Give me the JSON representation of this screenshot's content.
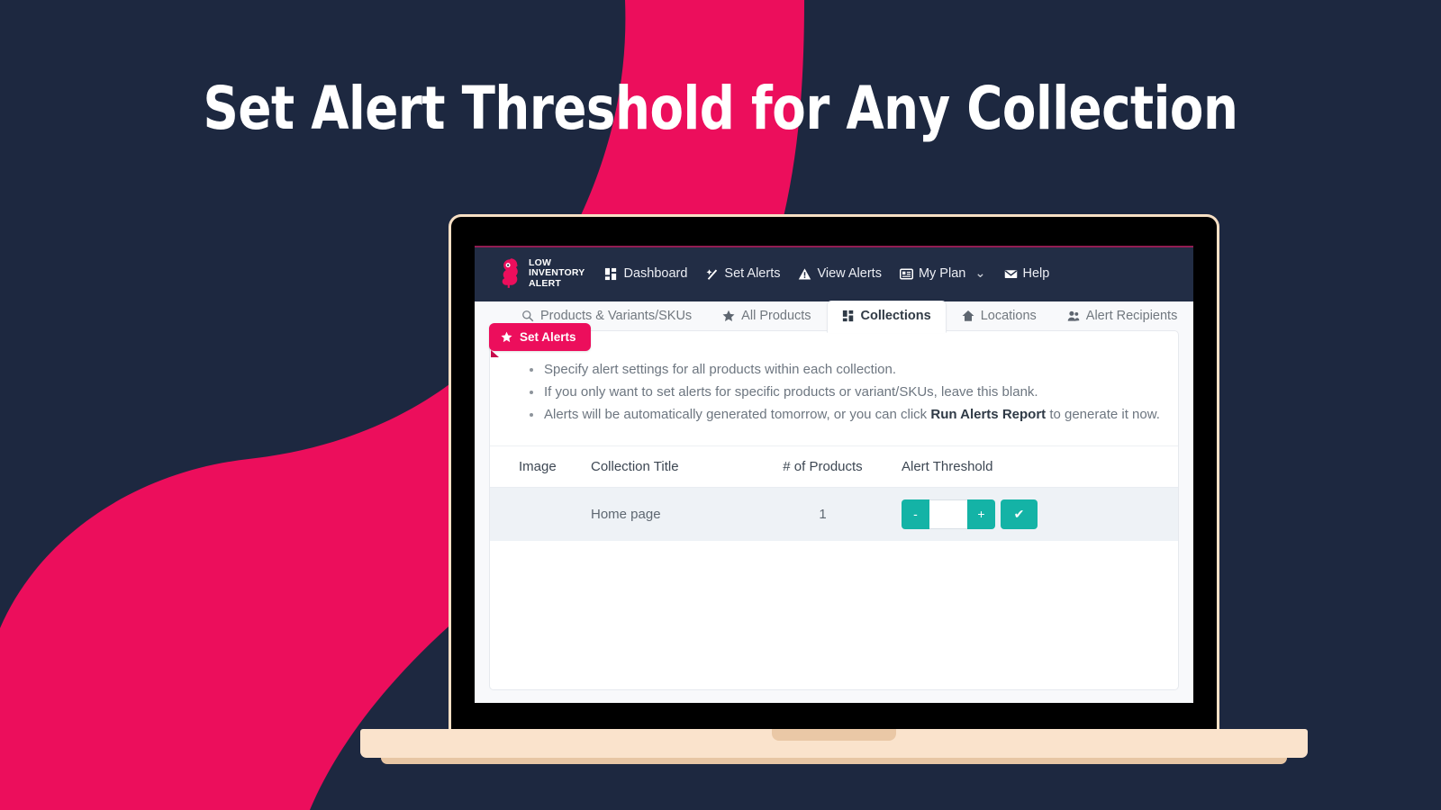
{
  "hero": {
    "title": "Set Alert Threshold for Any Collection"
  },
  "colors": {
    "background_navy": "#1d2840",
    "accent_pink": "#ec0e5c",
    "nav_navy": "#222d45",
    "teal": "#14b3a6",
    "laptop_base": "#fae3cc",
    "row_bg": "#eef2f6"
  },
  "app": {
    "brand": {
      "icon": "owl-bird-logo-icon",
      "line1": "LOW",
      "line2": "INVENTORY",
      "line3": "ALERT"
    },
    "nav_items": [
      {
        "label": "Dashboard",
        "icon": "grid-squares-icon"
      },
      {
        "label": "Set Alerts",
        "icon": "magic-wand-icon"
      },
      {
        "label": "View Alerts",
        "icon": "warning-triangle-icon"
      },
      {
        "label": "My Plan",
        "icon": "id-card-icon",
        "chevron": "⌄"
      },
      {
        "label": "Help",
        "icon": "envelope-icon"
      }
    ],
    "badge": {
      "label": "Set Alerts",
      "icon": "star-icon"
    },
    "tabs": [
      {
        "label": "Products & Variants/SKUs",
        "icon": "search-icon",
        "active": false
      },
      {
        "label": "All Products",
        "icon": "star-icon",
        "active": false
      },
      {
        "label": "Collections",
        "icon": "grid-squares-icon",
        "active": true
      },
      {
        "label": "Locations",
        "icon": "home-icon",
        "active": false
      },
      {
        "label": "Alert Recipients",
        "icon": "people-icon",
        "active": false
      },
      {
        "label": "",
        "icon": "gear-settings-icon",
        "active": false
      }
    ],
    "hints": [
      {
        "text": "Specify alert settings for all products within each collection."
      },
      {
        "text": "If you only want to set alerts for specific products or variant/SKUs, leave this blank."
      },
      {
        "pre": "Alerts will be automatically generated tomorrow, or you can click ",
        "strong": "Run Alerts Report",
        "post": " to generate it now."
      }
    ],
    "table": {
      "headers": [
        "Image",
        "Collection Title",
        "# of Products",
        "Alert Threshold",
        ""
      ],
      "rows": [
        {
          "image": "",
          "title": "Home page",
          "products": "1",
          "threshold_value": "",
          "threshold_placeholder": "",
          "minus_label": "-",
          "plus_label": "+",
          "confirm_label": "✔"
        }
      ]
    }
  }
}
